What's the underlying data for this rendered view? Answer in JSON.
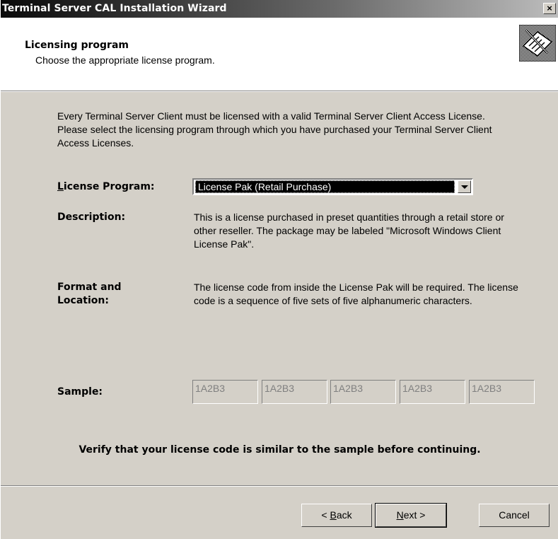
{
  "window": {
    "title": "Terminal Server CAL Installation Wizard",
    "close_glyph": "×"
  },
  "header": {
    "title": "Licensing program",
    "subtitle": "Choose the appropriate license program.",
    "icon": "license-certificate-icon"
  },
  "intro": "Every Terminal Server Client must be licensed with a valid Terminal Server Client Access License. Please select the licensing program through which you have purchased your Terminal Server Client Access Licenses.",
  "license_program": {
    "label_prefix": "",
    "label_access": "L",
    "label_rest": "icense Program:",
    "selected": "License Pak (Retail Purchase)"
  },
  "description": {
    "label": "Description:",
    "text": "This is a license purchased in preset quantities through a retail store or other reseller. The package may be labeled \"Microsoft Windows Client License Pak\"."
  },
  "format": {
    "label_line1": "Format and",
    "label_line2": "Location:",
    "text": "The license code from inside the License Pak will be required. The license code is a sequence of five sets of five alphanumeric characters."
  },
  "sample": {
    "label": "Sample:",
    "codes": [
      "1A2B3",
      "1A2B3",
      "1A2B3",
      "1A2B3",
      "1A2B3"
    ]
  },
  "verify_text": "Verify that your license code is similar to the sample before continuing.",
  "buttons": {
    "back_pre": "< ",
    "back_access": "B",
    "back_rest": "ack",
    "next_access": "N",
    "next_rest": "ext >",
    "cancel": "Cancel"
  }
}
